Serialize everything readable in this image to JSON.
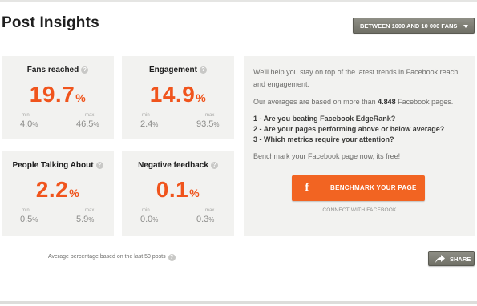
{
  "page": {
    "title": "Post Insights",
    "filter_label": "BETWEEN 1000 AND 10 000 FANS"
  },
  "metrics": [
    {
      "label": "Fans reached",
      "help": "?",
      "value": "19.7",
      "unit": "%",
      "min_label": "min",
      "min": "4.0",
      "max_label": "max",
      "max": "46.5"
    },
    {
      "label": "Engagement",
      "help": "?",
      "value": "14.9",
      "unit": "%",
      "min_label": "min",
      "min": "2.4",
      "max_label": "max",
      "max": "93.5"
    },
    {
      "label": "People Talking About",
      "help": "?",
      "value": "2.2",
      "unit": "%",
      "min_label": "min",
      "min": "0.5",
      "max_label": "max",
      "max": "5.9"
    },
    {
      "label": "Negative feedback",
      "help": "?",
      "value": "0.1",
      "unit": "%",
      "min_label": "min",
      "min": "0.0",
      "max_label": "max",
      "max": "0.3"
    }
  ],
  "info": {
    "intro": "We'll help you stay on top of the latest trends in Facebook reach and engagement.",
    "avg_prefix": "Our averages are based on more than",
    "avg_count": "4.848",
    "avg_suffix": "Facebook pages.",
    "questions": [
      "1 - Are you beating Facebook EdgeRank?",
      "2 - Are your pages performing above or below average?",
      "3 - Which metrics require your attention?"
    ],
    "benchmark_text": "Benchmark your Facebook page now, its free!",
    "fb_icon": "f",
    "button_label": "BENCHMARK YOUR PAGE",
    "connect_label": "CONNECT WITH FACEBOOK"
  },
  "footer": {
    "note": "Average percentage based on the last 50 posts",
    "help": "?",
    "share_label": "SHARE"
  },
  "colors": {
    "accent": "#f0541c",
    "button_orange": "#f26422",
    "card_bg": "#f2f2f0",
    "button_gray": "#7f7f76"
  },
  "icons": {
    "help": "question-circle-icon",
    "caret": "caret-down-icon",
    "facebook": "facebook-icon",
    "share": "share-arrow-icon"
  }
}
